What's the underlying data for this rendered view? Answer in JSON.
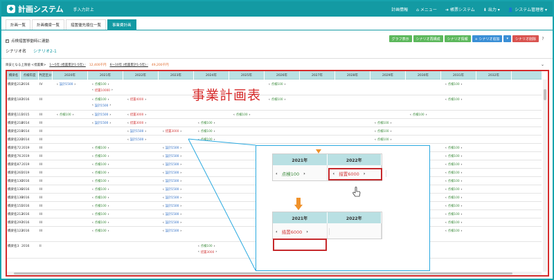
{
  "header": {
    "brand": "計画システム",
    "subtitle": "手入力計上",
    "nav": [
      {
        "icon": "gauge-icon",
        "label": "計画情報"
      },
      {
        "icon": "home-icon",
        "label": "メニュー"
      },
      {
        "icon": "arrow-right-icon",
        "label": "帳票システム"
      },
      {
        "icon": "download-icon",
        "label": "出力"
      },
      {
        "icon": "user-icon",
        "label": "システム管理者"
      }
    ]
  },
  "tabs": [
    "計画一覧",
    "計画橋梁一覧",
    "措置優先順位一覧",
    "事業費計画"
  ],
  "active_tab": 3,
  "toolbar": {
    "checkbox_label": "点検措置移動時に連動",
    "buttons": [
      "グラフ表示",
      "シナリオ再構成",
      "シナリオ情報",
      "+ シナリオ追加",
      "シナリオ削除"
    ]
  },
  "scenario_tabs": [
    "シナリオ名",
    "シナリオ2-1"
  ],
  "guide": {
    "label": "目安となる上限値 <措置費>",
    "range1": "1〜5年 (措置累計1-5年) :",
    "range1_value": "12,400千円",
    "range2": "6〜10年 (措置累計1-5年) :",
    "range2_value": "49,200千円"
  },
  "table": {
    "header": [
      "橋梁名",
      "点検年度",
      "判定区分",
      "2020年",
      "2021年",
      "2022年",
      "2023年",
      "2024年",
      "2025年",
      "2026年",
      "2027年",
      "2028年",
      "2029年",
      "2030年",
      "2031年",
      "2032年"
    ],
    "rows": [
      {
        "name": "橋梁名212",
        "year": "2016",
        "cat": "IV"
      },
      {
        "name": "橋梁名187",
        "year": "2016",
        "cat": "III"
      },
      {
        "name": "橋梁名111",
        "year": "2015",
        "cat": "III"
      },
      {
        "name": "橋梁名218",
        "year": "2014",
        "cat": "III"
      },
      {
        "name": "橋梁名219",
        "year": "2014",
        "cat": "III"
      },
      {
        "name": "橋梁名220",
        "year": "2014",
        "cat": "III"
      },
      {
        "name": "橋梁名72",
        "year": "2019",
        "cat": "III"
      },
      {
        "name": "橋梁名76",
        "year": "2019",
        "cat": "III"
      },
      {
        "name": "橋梁名87",
        "year": "2019",
        "cat": "III"
      },
      {
        "name": "橋梁名261",
        "year": "2019",
        "cat": "III"
      },
      {
        "name": "橋梁名130",
        "year": "2016",
        "cat": "III"
      },
      {
        "name": "橋梁名136",
        "year": "2016",
        "cat": "III"
      },
      {
        "name": "橋梁名139",
        "year": "2016",
        "cat": "III"
      },
      {
        "name": "橋梁名151",
        "year": "2016",
        "cat": "III"
      },
      {
        "name": "橋梁名213",
        "year": "2016",
        "cat": "III"
      },
      {
        "name": "橋梁名297",
        "year": "2016",
        "cat": "III"
      },
      {
        "name": "橋梁名123",
        "year": "2016",
        "cat": "III"
      },
      {
        "name": "橋梁名3",
        "year": "2016",
        "cat": "II"
      }
    ],
    "pills": [
      {
        "row": 0,
        "col": 3,
        "kind": "b",
        "text": "設計1500"
      },
      {
        "row": 0,
        "col": 4,
        "kind": "g",
        "text": "点検100"
      },
      {
        "row": 0,
        "col": 4,
        "kind": "r",
        "text": "措置10000",
        "sub": true
      },
      {
        "row": 0,
        "col": 9,
        "kind": "g",
        "text": "点検100"
      },
      {
        "row": 0,
        "col": 14,
        "kind": "g",
        "text": "点検100"
      },
      {
        "row": 1,
        "col": 4,
        "kind": "g",
        "text": "点検100"
      },
      {
        "row": 1,
        "col": 4,
        "kind": "b",
        "text": "設計1500",
        "sub": true
      },
      {
        "row": 1,
        "col": 5,
        "kind": "r",
        "text": "措置4000"
      },
      {
        "row": 1,
        "col": 9,
        "kind": "g",
        "text": "点検100"
      },
      {
        "row": 1,
        "col": 14,
        "kind": "g",
        "text": "点検100"
      },
      {
        "row": 2,
        "col": 3,
        "kind": "g",
        "text": "点検100"
      },
      {
        "row": 2,
        "col": 4,
        "kind": "b",
        "text": "設計1500"
      },
      {
        "row": 2,
        "col": 5,
        "kind": "r",
        "text": "措置3000"
      },
      {
        "row": 2,
        "col": 8,
        "kind": "g",
        "text": "点検100"
      },
      {
        "row": 2,
        "col": 13,
        "kind": "g",
        "text": "点検100"
      },
      {
        "row": 3,
        "col": 4,
        "kind": "b",
        "text": "設計1500"
      },
      {
        "row": 3,
        "col": 5,
        "kind": "r",
        "text": "措置3000"
      },
      {
        "row": 3,
        "col": 7,
        "kind": "g",
        "text": "点検100"
      },
      {
        "row": 3,
        "col": 12,
        "kind": "g",
        "text": "点検100"
      },
      {
        "row": 4,
        "col": 5,
        "kind": "b",
        "text": "設計1500"
      },
      {
        "row": 4,
        "col": 6,
        "kind": "r",
        "text": "措置3000"
      },
      {
        "row": 4,
        "col": 7,
        "kind": "g",
        "text": "点検100"
      },
      {
        "row": 4,
        "col": 12,
        "kind": "g",
        "text": "点検100"
      },
      {
        "row": 5,
        "col": 5,
        "kind": "b",
        "text": "設計1500"
      },
      {
        "row": 5,
        "col": 7,
        "kind": "g",
        "text": "点検100"
      },
      {
        "row": 5,
        "col": 12,
        "kind": "g",
        "text": "点検100"
      },
      {
        "row": 6,
        "col": 4,
        "kind": "g",
        "text": "点検100"
      },
      {
        "row": 6,
        "col": 6,
        "kind": "b",
        "text": "設計1500"
      },
      {
        "row": 6,
        "col": 14,
        "kind": "g",
        "text": "点検100"
      },
      {
        "row": 7,
        "col": 4,
        "kind": "g",
        "text": "点検100"
      },
      {
        "row": 7,
        "col": 6,
        "kind": "b",
        "text": "設計1500"
      },
      {
        "row": 7,
        "col": 14,
        "kind": "g",
        "text": "点検100"
      },
      {
        "row": 8,
        "col": 4,
        "kind": "g",
        "text": "点検100"
      },
      {
        "row": 8,
        "col": 6,
        "kind": "b",
        "text": "設計1500"
      },
      {
        "row": 8,
        "col": 14,
        "kind": "g",
        "text": "点検100"
      },
      {
        "row": 9,
        "col": 4,
        "kind": "g",
        "text": "点検100"
      },
      {
        "row": 9,
        "col": 6,
        "kind": "b",
        "text": "設計1500"
      },
      {
        "row": 9,
        "col": 14,
        "kind": "g",
        "text": "点検100"
      },
      {
        "row": 10,
        "col": 4,
        "kind": "g",
        "text": "点検100"
      },
      {
        "row": 10,
        "col": 6,
        "kind": "b",
        "text": "設計1500"
      },
      {
        "row": 10,
        "col": 14,
        "kind": "g",
        "text": "点検100"
      },
      {
        "row": 11,
        "col": 4,
        "kind": "g",
        "text": "点検100"
      },
      {
        "row": 11,
        "col": 6,
        "kind": "b",
        "text": "設計1500"
      },
      {
        "row": 11,
        "col": 14,
        "kind": "g",
        "text": "点検100"
      },
      {
        "row": 12,
        "col": 4,
        "kind": "g",
        "text": "点検100"
      },
      {
        "row": 12,
        "col": 6,
        "kind": "b",
        "text": "設計1500"
      },
      {
        "row": 12,
        "col": 14,
        "kind": "g",
        "text": "点検100"
      },
      {
        "row": 13,
        "col": 4,
        "kind": "g",
        "text": "点検100"
      },
      {
        "row": 13,
        "col": 6,
        "kind": "b",
        "text": "設計1500"
      },
      {
        "row": 13,
        "col": 14,
        "kind": "g",
        "text": "点検100"
      },
      {
        "row": 14,
        "col": 4,
        "kind": "g",
        "text": "点検100"
      },
      {
        "row": 14,
        "col": 6,
        "kind": "b",
        "text": "設計1500"
      },
      {
        "row": 14,
        "col": 14,
        "kind": "g",
        "text": "点検100"
      },
      {
        "row": 15,
        "col": 4,
        "kind": "g",
        "text": "点検100"
      },
      {
        "row": 15,
        "col": 6,
        "kind": "b",
        "text": "設計1500"
      },
      {
        "row": 15,
        "col": 14,
        "kind": "g",
        "text": "点検100"
      },
      {
        "row": 16,
        "col": 4,
        "kind": "g",
        "text": "点検100"
      },
      {
        "row": 16,
        "col": 6,
        "kind": "b",
        "text": "設計1500"
      },
      {
        "row": 16,
        "col": 14,
        "kind": "g",
        "text": "点検100"
      },
      {
        "row": 17,
        "col": 7,
        "kind": "g",
        "text": "点検100"
      },
      {
        "row": 17,
        "col": 7,
        "kind": "r",
        "text": "措置3000",
        "sub": true
      }
    ]
  },
  "overlay": {
    "title": "事業計画表",
    "before": {
      "years": [
        "2021年",
        "2022年"
      ],
      "left": "点検100",
      "right": "措置6000"
    },
    "after": {
      "years": [
        "2021年",
        "2022年"
      ],
      "left": "措置6000"
    }
  },
  "colors": {
    "accent": "#139aa3",
    "highlight": "#d62b2b",
    "callout": "#29a9e0",
    "arrow": "#f0922b"
  }
}
